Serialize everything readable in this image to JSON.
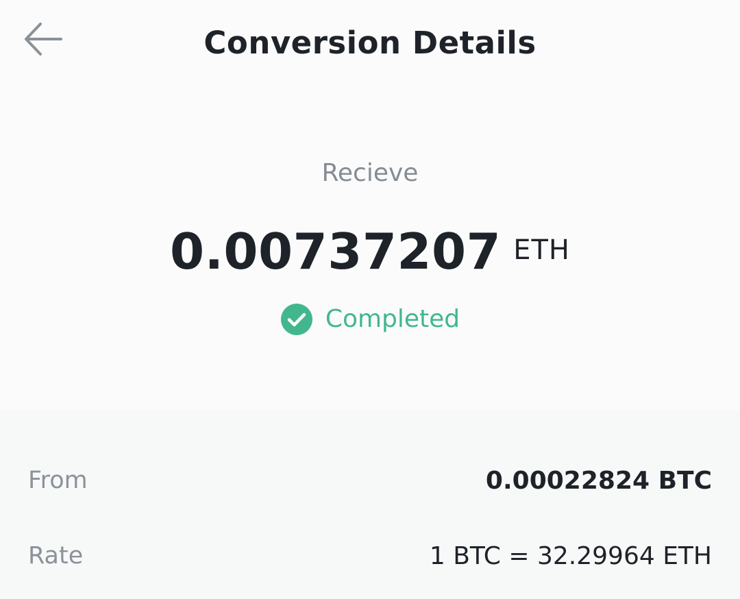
{
  "header": {
    "title": "Conversion Details",
    "back_icon": "arrow-left-icon"
  },
  "summary": {
    "label": "Recieve",
    "amount": "0.00737207",
    "unit": "ETH",
    "status": "Completed",
    "status_icon": "check-circle-icon",
    "status_color": "#42b78d"
  },
  "details": {
    "from_label": "From",
    "from_value": "0.00022824 BTC",
    "rate_label": "Rate",
    "rate_value": "1 BTC = 32.29964 ETH"
  },
  "colors": {
    "text_primary": "#1e2329",
    "text_secondary": "#858c93",
    "background_top": "#fbfbfb",
    "background_details": "#f7f8f8"
  }
}
